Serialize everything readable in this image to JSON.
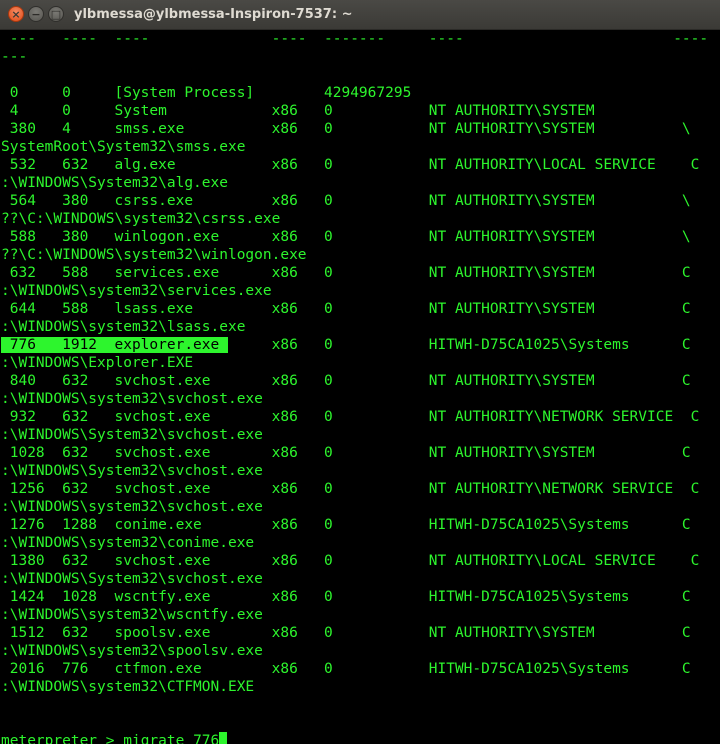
{
  "window": {
    "title": "ylbmessa@ylbmessa-Inspiron-7537: ~",
    "buttons": {
      "close": "×",
      "minimize": "−",
      "maximize": "□"
    }
  },
  "colors": {
    "text": "#2df52d",
    "background": "#000000",
    "titlebar": "#3e3d39"
  },
  "terminal": {
    "lines": [
      " ---   ----  ----              ----  -------     ----                        ----",
      "---",
      "",
      " 0     0     [System Process]        4294967295",
      " 4     0     System            x86   0           NT AUTHORITY\\SYSTEM",
      " 380   4     smss.exe          x86   0           NT AUTHORITY\\SYSTEM          \\",
      "SystemRoot\\System32\\smss.exe",
      " 532   632   alg.exe           x86   0           NT AUTHORITY\\LOCAL SERVICE    C",
      ":\\WINDOWS\\System32\\alg.exe",
      " 564   380   csrss.exe         x86   0           NT AUTHORITY\\SYSTEM          \\",
      "??\\C:\\WINDOWS\\system32\\csrss.exe",
      " 588   380   winlogon.exe      x86   0           NT AUTHORITY\\SYSTEM          \\",
      "??\\C:\\WINDOWS\\system32\\winlogon.exe",
      " 632   588   services.exe      x86   0           NT AUTHORITY\\SYSTEM          C",
      ":\\WINDOWS\\system32\\services.exe",
      " 644   588   lsass.exe         x86   0           NT AUTHORITY\\SYSTEM          C",
      ":\\WINDOWS\\system32\\lsass.exe",
      "HIGHLIGHT",
      ":\\WINDOWS\\Explorer.EXE",
      " 840   632   svchost.exe       x86   0           NT AUTHORITY\\SYSTEM          C",
      ":\\WINDOWS\\system32\\svchost.exe",
      " 932   632   svchost.exe       x86   0           NT AUTHORITY\\NETWORK SERVICE  C",
      ":\\WINDOWS\\System32\\svchost.exe",
      " 1028  632   svchost.exe       x86   0           NT AUTHORITY\\SYSTEM          C",
      ":\\WINDOWS\\System32\\svchost.exe",
      " 1256  632   svchost.exe       x86   0           NT AUTHORITY\\NETWORK SERVICE  C",
      ":\\WINDOWS\\system32\\svchost.exe",
      " 1276  1288  conime.exe        x86   0           HITWH-D75CA1025\\Systems      C",
      ":\\WINDOWS\\system32\\conime.exe",
      " 1380  632   svchost.exe       x86   0           NT AUTHORITY\\LOCAL SERVICE    C",
      ":\\WINDOWS\\System32\\svchost.exe",
      " 1424  1028  wscntfy.exe       x86   0           HITWH-D75CA1025\\Systems      C",
      ":\\WINDOWS\\system32\\wscntfy.exe",
      " 1512  632   spoolsv.exe       x86   0           NT AUTHORITY\\SYSTEM          C",
      ":\\WINDOWS\\system32\\spoolsv.exe",
      " 2016  776   ctfmon.exe        x86   0           HITWH-D75CA1025\\Systems      C",
      ":\\WINDOWS\\system32\\CTFMON.EXE"
    ],
    "highlighted_row": {
      "selected": " 776   1912  explorer.exe ",
      "rest": "     x86   0           HITWH-D75CA1025\\Systems      C"
    },
    "prompt": {
      "name": "meterpreter",
      "separator": " > ",
      "command": "migrate 776"
    }
  }
}
